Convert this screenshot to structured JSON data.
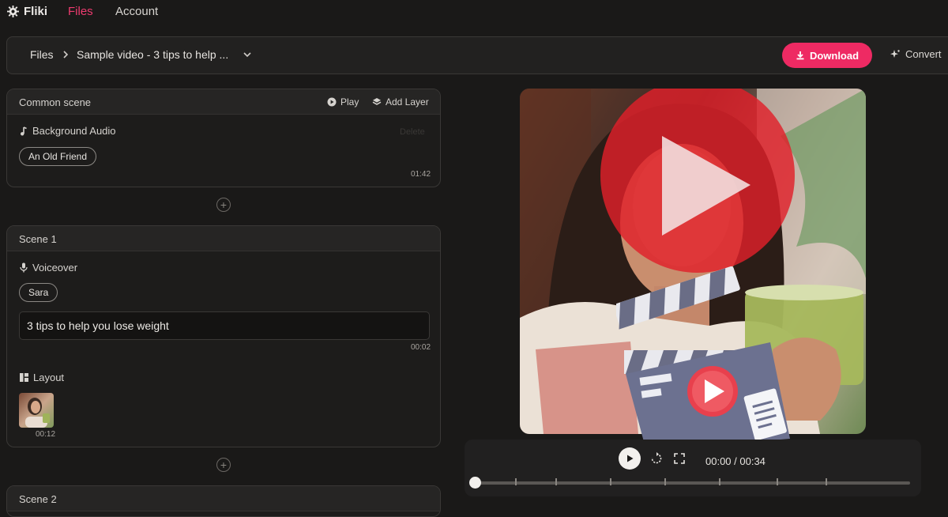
{
  "nav": {
    "logo_text": "Fliki",
    "links": [
      {
        "label": "Files",
        "active": true
      },
      {
        "label": "Account",
        "active": false
      }
    ]
  },
  "toolbar": {
    "breadcrumb_root": "Files",
    "breadcrumb_current": "Sample video - 3 tips to help ...",
    "download_label": "Download",
    "convert_label": "Convert"
  },
  "common_scene": {
    "title": "Common scene",
    "play_label": "Play",
    "add_layer_label": "Add Layer",
    "background_audio_label": "Background Audio",
    "faded_action": "Delete",
    "audio_chip": "An Old Friend",
    "duration": "01:42"
  },
  "scene1": {
    "title": "Scene 1",
    "voiceover_label": "Voiceover",
    "voice_chip": "Sara",
    "text": "3 tips to help you lose weight",
    "text_duration": "00:02",
    "layout_label": "Layout",
    "layout_duration": "00:12"
  },
  "scene2": {
    "title": "Scene 2"
  },
  "player": {
    "time": "00:00 / 00:34",
    "progress": 0
  },
  "colors": {
    "accent": "#ee2a63",
    "background": "#1a1918",
    "card": "#1d1c1b"
  }
}
